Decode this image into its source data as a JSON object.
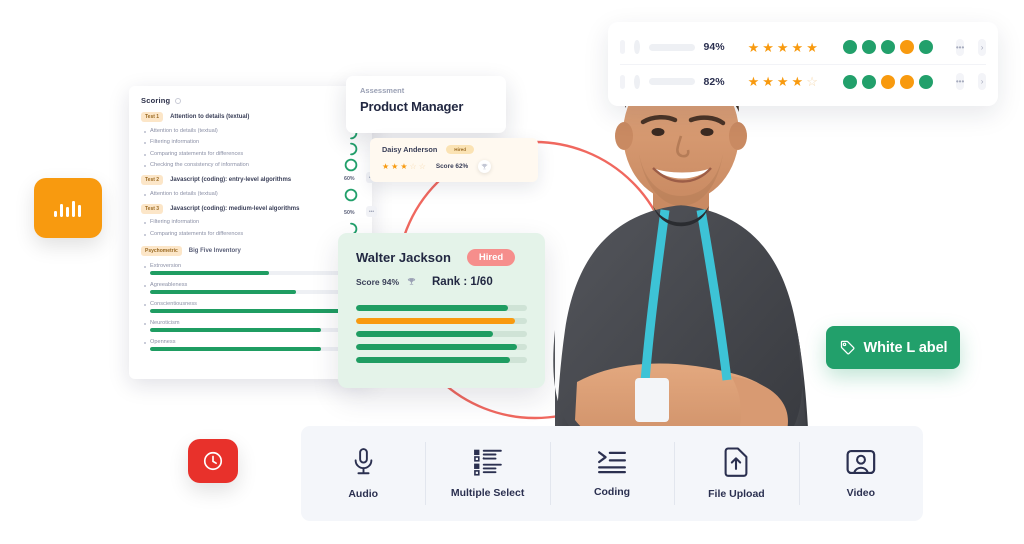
{
  "scoring_panel": {
    "title": "Scoring",
    "info_icon": "info-icon",
    "tests": [
      {
        "badge": "Test 1",
        "name": "Attention to details (textual)",
        "items": [
          "Attention to details (textual)",
          "Filtering information",
          "Comparing statements for differences",
          "Checking the consistency of information"
        ]
      },
      {
        "badge": "Test 2",
        "name": "Javascript (coding): entry-level algorithms",
        "items": [
          "Attention to details (textual)"
        ]
      },
      {
        "badge": "Test 3",
        "name": "Javascript (coding): medium-level algorithms",
        "items": [
          "Filtering information",
          "Comparing statements for differences"
        ]
      }
    ],
    "psychometric": {
      "badge": "Psychometric",
      "name": "Big Five Inventory",
      "traits": [
        {
          "label": "Extroversion",
          "value": 57
        },
        {
          "label": "Agreeableness",
          "value": 70
        },
        {
          "label": "Conscientiousness",
          "value": 100
        },
        {
          "label": "Neuroticism",
          "value": 82
        },
        {
          "label": "Openness",
          "value": 82
        }
      ],
      "bar_color": "#1F9D62"
    }
  },
  "rings_column": {
    "percent_1": "60%",
    "percent_2": "50%",
    "ring_color": "#22A06B",
    "chip_icon": "ellipsis-icon"
  },
  "assessment_card": {
    "label": "Assessment",
    "title": "Product Manager"
  },
  "daisy_card": {
    "name": "Daisy Anderson",
    "status": "Hired",
    "stars_filled": 3,
    "stars_total": 5,
    "score": "Score 62%",
    "trophy_icon": "trophy-icon"
  },
  "walter_card": {
    "name": "Walter Jackson",
    "status": "Hired",
    "score": "Score 94%",
    "trophy_icon": "trophy-icon",
    "rank": "Rank : 1/60",
    "bars": [
      {
        "value": 89,
        "color": "#1F9D62"
      },
      {
        "value": 93,
        "color": "#F89A0F"
      },
      {
        "value": 80,
        "color": "#1F9D62"
      },
      {
        "value": 94,
        "color": "#1F9D62"
      },
      {
        "value": 90,
        "color": "#1F9D62"
      }
    ],
    "hired_chip_color": "#F68E8C",
    "background": "#E4F3E9"
  },
  "rank_table": {
    "rows": [
      {
        "checkbox": "checkbox-unchecked",
        "percent": "94%",
        "stars_filled": 5,
        "stars_total": 5,
        "dots": [
          "#22A06B",
          "#22A06B",
          "#22A06B",
          "#F89A0F",
          "#22A06B"
        ],
        "more_icon": "ellipsis-icon",
        "open_icon": "chevron-right-icon"
      },
      {
        "checkbox": "checkbox-unchecked",
        "percent": "82%",
        "stars_filled": 4,
        "stars_total": 5,
        "dots": [
          "#22A06B",
          "#22A06B",
          "#F89A0F",
          "#F89A0F",
          "#22A06B"
        ],
        "more_icon": "ellipsis-icon",
        "open_icon": "chevron-right-icon"
      }
    ]
  },
  "white_label_badge": {
    "text": "White L abel",
    "icon": "tag-icon",
    "color": "#22A06B"
  },
  "tiles": [
    {
      "name": "analytics-tile",
      "icon": "bar-chart-icon",
      "color": "#F89A0F"
    },
    {
      "name": "timer-tile",
      "icon": "clock-icon",
      "color": "#E8312B"
    }
  ],
  "toolbar": {
    "items": [
      {
        "label": "Audio",
        "icon": "microphone-icon"
      },
      {
        "label": "Multiple Select",
        "icon": "checklist-icon"
      },
      {
        "label": "Coding",
        "icon": "code-icon"
      },
      {
        "label": "File Upload",
        "icon": "file-upload-icon"
      },
      {
        "label": "Video",
        "icon": "video-person-icon"
      }
    ]
  },
  "photo": {
    "alt": "smiling-man-arms-crossed-with-lanyard"
  },
  "decor": {
    "arc_color": "#F0685F"
  }
}
